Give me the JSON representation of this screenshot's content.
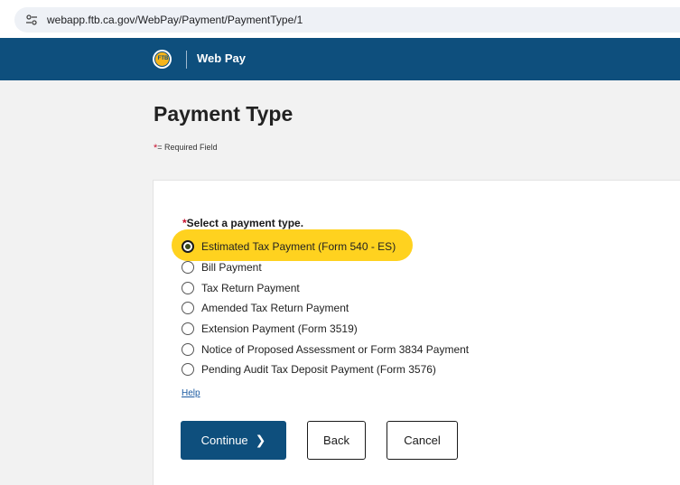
{
  "browser": {
    "url": "webapp.ftb.ca.gov/WebPay/Payment/PaymentType/1"
  },
  "header": {
    "logo_text": "FTB",
    "brand": "Web Pay",
    "color": "#0e4f7d"
  },
  "page": {
    "title": "Payment Type",
    "required_star": "*",
    "required_note": "= Required Field"
  },
  "form": {
    "question_star": "*",
    "question": "Select a payment type.",
    "selected_index": 0,
    "options": [
      {
        "label": "Estimated Tax Payment (Form 540 - ES)",
        "checked": true
      },
      {
        "label": "Bill Payment",
        "checked": false
      },
      {
        "label": "Tax Return Payment",
        "checked": false
      },
      {
        "label": "Amended Tax Return Payment",
        "checked": false
      },
      {
        "label": "Extension Payment (Form 3519)",
        "checked": false
      },
      {
        "label": "Notice of Proposed Assessment or Form 3834 Payment",
        "checked": false
      },
      {
        "label": "Pending Audit Tax Deposit Payment (Form 3576)",
        "checked": false
      }
    ],
    "help": "Help"
  },
  "buttons": {
    "continue": "Continue",
    "continue_icon": "chevron-right-icon",
    "back": "Back",
    "cancel": "Cancel"
  },
  "colors": {
    "highlight": "#ffd21f",
    "required": "#c8102e",
    "link": "#1a5aa0"
  }
}
